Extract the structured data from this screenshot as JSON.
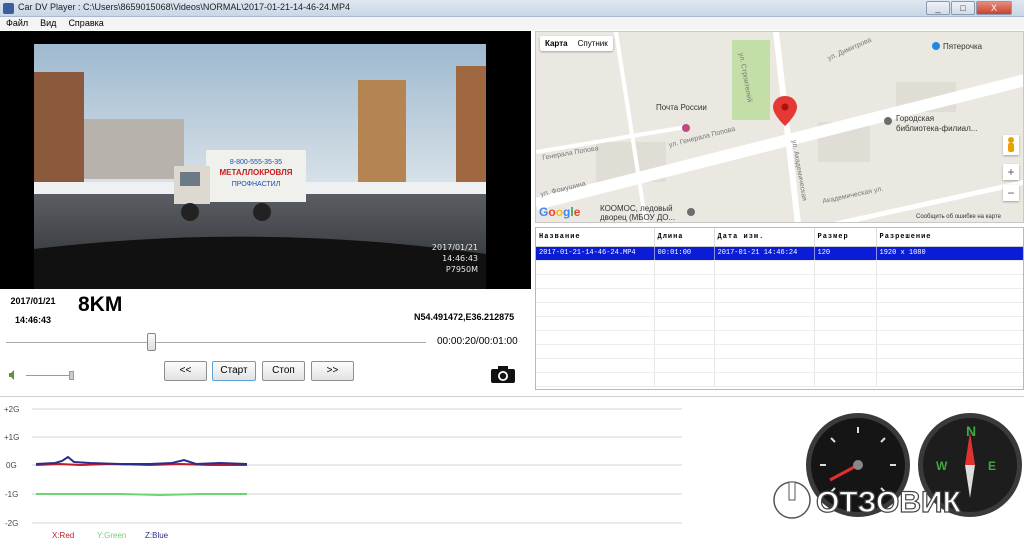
{
  "window": {
    "title": "Car DV Player : C:\\Users\\8659015068\\Videos\\NORMAL\\2017-01-21-14-46-24.MP4",
    "controls": [
      "_",
      "□",
      "X"
    ]
  },
  "menu": [
    "Файл",
    "Вид",
    "Справка"
  ],
  "video": {
    "overlay_date": "2017/01/21",
    "overlay_time": "14:46:43",
    "overlay_id": "P7950M",
    "truck_sign_line1": "8-800-555-35-35",
    "truck_sign_line2": "МЕТАЛЛОКРОВЛЯ",
    "truck_sign_line3": "ПРОФНАСТИЛ"
  },
  "info": {
    "date": "2017/01/21",
    "time": "14:46:43",
    "speed": "8KM",
    "coords": "N54.491472,E36.212875"
  },
  "playback": {
    "progress": 0.333,
    "time": "00:00:20/00:01:00",
    "volume": 0.95,
    "buttons": {
      "prev": "<<",
      "start": "Старт",
      "stop": "Стоп",
      "next": ">>"
    }
  },
  "map": {
    "tabs": [
      "Карта",
      "Спутник"
    ],
    "labels": {
      "pyaterochka": "Пятерочка",
      "pochta": "Почта России",
      "library_1": "Городская",
      "library_2": "библиотека-филиал...",
      "kosmos_1": "КООМОС, ледовый",
      "kosmos_2": "дворец (МБОУ ДО...",
      "street_popova_1": "Генерала Попова",
      "street_popova_2": "ул. Генерала Попова",
      "street_fomushina": "ул. Фомушина",
      "street_akad": "ул. Академическая",
      "street_dimitrova": "ул. Димитрова",
      "street_akad2": "Академическая ул.",
      "street_stroitelei": "ул. Строителей",
      "terms": "Сообщить об ошибке на карте"
    },
    "zoom_in": "+",
    "zoom_out": "−",
    "logo": "Google"
  },
  "files": {
    "columns": [
      "Название",
      "Длина",
      "Дата изм.",
      "Размер",
      "Разрешение"
    ],
    "rows": [
      [
        "2017-01-21-14-46-24.MP4",
        "00:01:00",
        "2017-01-21 14:46:24",
        "120",
        "1920 x 1080"
      ]
    ],
    "empty_rows": 9
  },
  "gsensor": {
    "y_labels": [
      "+2G",
      "+1G",
      "0G",
      "-1G",
      "-2G"
    ],
    "legend": {
      "x": "X:Red",
      "y": "Y:Green",
      "z": "Z:Blue"
    },
    "colors": {
      "x": "#c01a2c",
      "y": "#6fd36f",
      "z": "#2c2c8c"
    }
  },
  "watermark": "ОТЗОВИК"
}
